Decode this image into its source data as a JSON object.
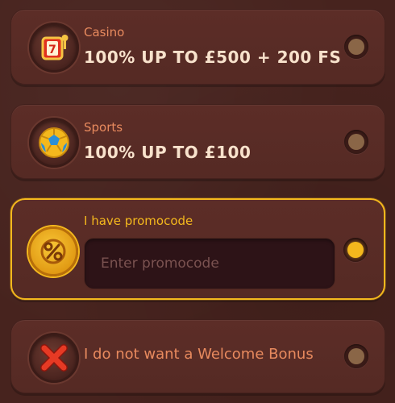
{
  "bonus_options": {
    "casino": {
      "category": "Casino",
      "offer": "100% UP TO £500 + 200 FS",
      "icon": "slot-machine-icon",
      "selected": false
    },
    "sports": {
      "category": "Sports",
      "offer": "100% UP TO £100",
      "icon": "soccer-ball-icon",
      "selected": false
    },
    "promocode": {
      "label": "I have promocode",
      "input_placeholder": "Enter promocode",
      "input_value": "",
      "icon": "percent-coin-icon",
      "selected": true
    },
    "no_bonus": {
      "label": "I do not want a Welcome Bonus",
      "icon": "red-x-icon",
      "selected": false
    }
  },
  "colors": {
    "background": "#47231e",
    "card": "#5c2d27",
    "accent_gold": "#f4b81d",
    "label_orange": "#e88a5e",
    "text_cream": "#f8e2cc",
    "radio_off": "#8a6647"
  }
}
